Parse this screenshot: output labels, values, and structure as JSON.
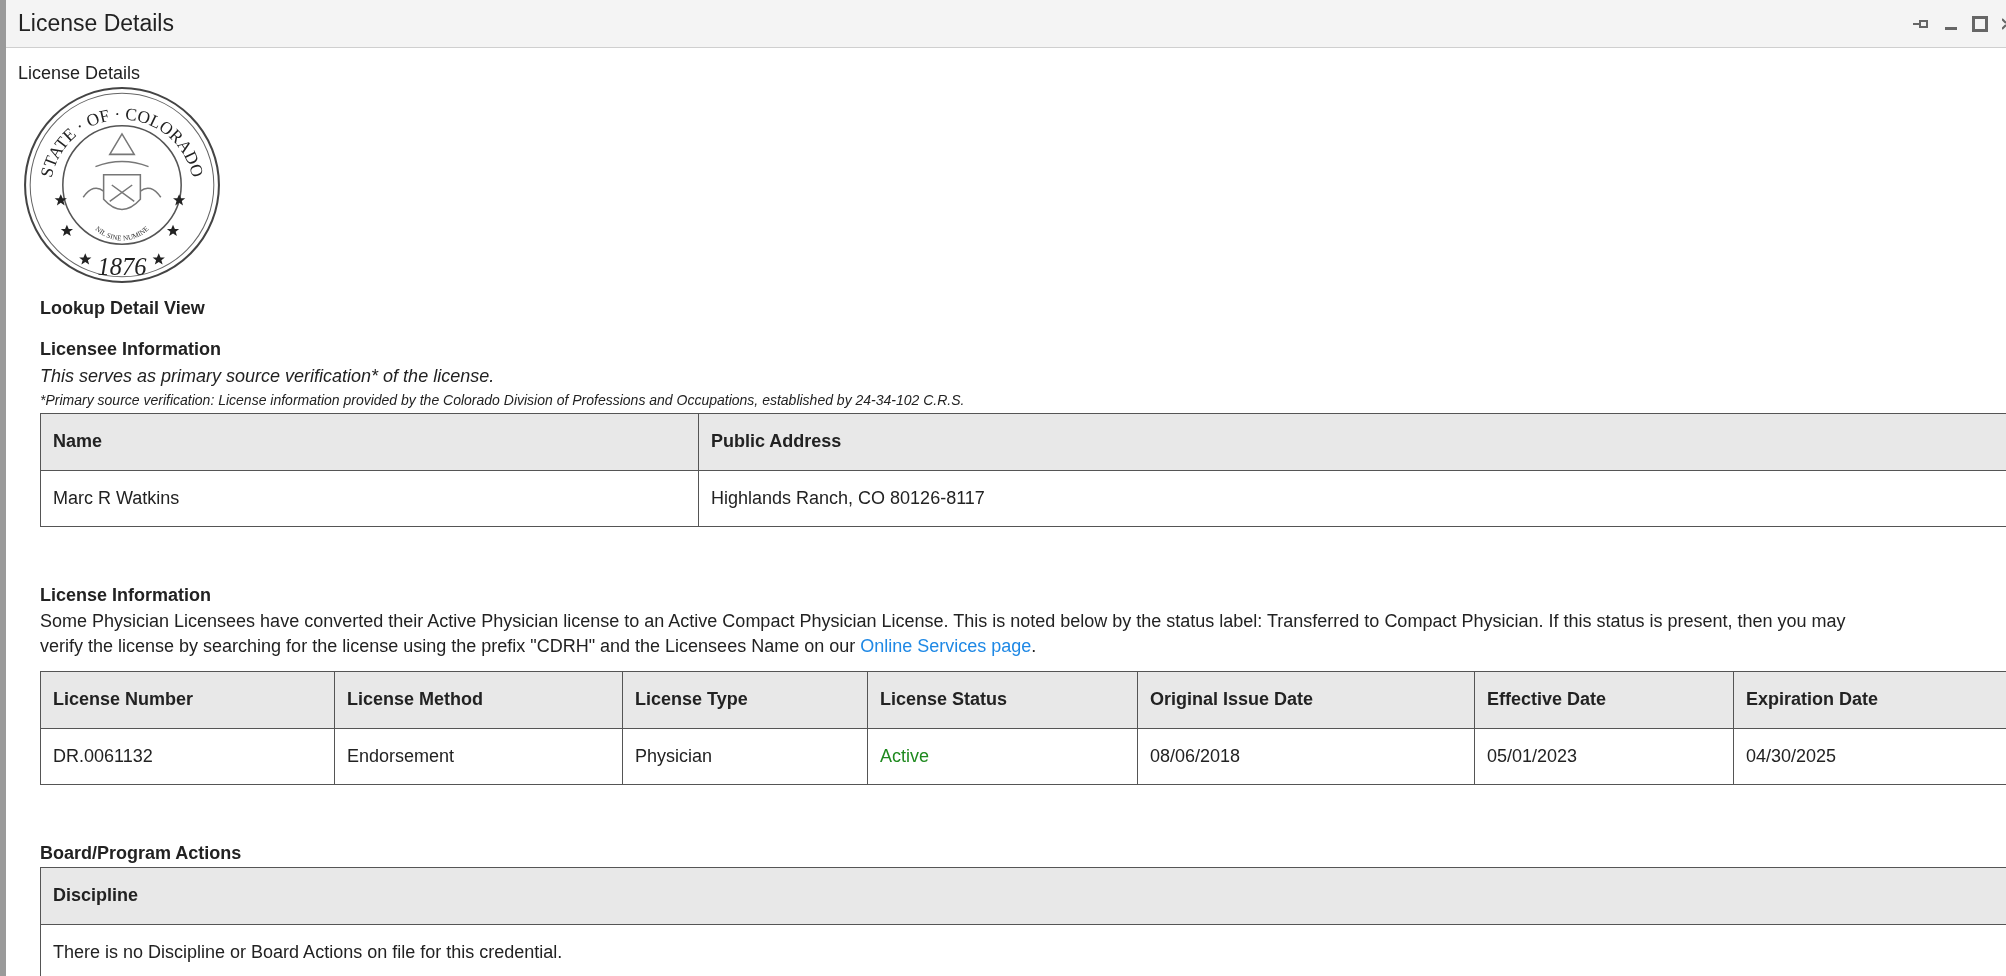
{
  "window": {
    "title": "License Details"
  },
  "page_heading": "License Details",
  "seal": {
    "ring_text": "STATE · OF · COLORADO",
    "motto": "NIL SINE NUMINE",
    "year": "1876"
  },
  "view_title": "Lookup Detail View",
  "licensee": {
    "heading": "Licensee Information",
    "note": "This serves as primary source verification* of the license.",
    "footnote": "*Primary source verification: License information provided by the Colorado Division of Professions and Occupations, established by 24-34-102 C.R.S.",
    "columns": [
      "Name",
      "Public Address"
    ],
    "rows": [
      [
        "Marc R Watkins",
        "Highlands Ranch, CO 80126-8117"
      ]
    ]
  },
  "license": {
    "heading": "License Information",
    "text": "Some Physician Licensees have converted their Active Physician license to an Active Compact Physician License. This is noted below by the status label: Transferred to Compact Physician. If this status is present, then you may verify the license by searching for the license using the prefix \"CDRH\" and the Licensees Name on our",
    "link": "Online Services page",
    "after_link": ".",
    "columns": [
      "License Number",
      "License Method",
      "License Type",
      "License Status",
      "Original Issue Date",
      "Effective Date",
      "Expiration Date"
    ],
    "rows": [
      {
        "cells": [
          "DR.0061132",
          "Endorsement",
          "Physician",
          "Active",
          "08/06/2018",
          "05/01/2023",
          "04/30/2025"
        ],
        "color": "#1f8a1f"
      }
    ]
  },
  "actions": {
    "heading": "Board/Program Actions",
    "columns": [
      "Discipline"
    ],
    "rows": [
      [
        "There is no Discipline or Board Actions on file for this credential."
      ]
    ]
  }
}
